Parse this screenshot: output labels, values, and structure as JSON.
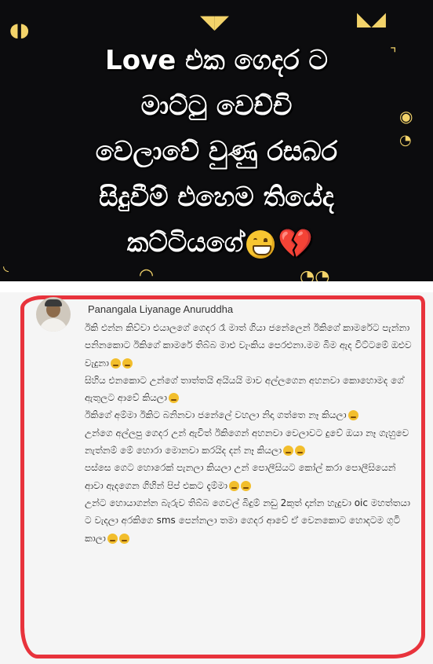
{
  "banner": {
    "lines": [
      "Love එක ගෙදර ට",
      "මාට්ටු වෙච්චි",
      "වෙලාවේ වුණු රසබර",
      "සිදුවීම් එහෙම තියේද",
      "කට්ටියගේ"
    ],
    "emoji_end": [
      "grinning-face-icon",
      "broken-heart-icon"
    ]
  },
  "comment": {
    "author": "Panangala Liyanage Anuruddha",
    "paragraphs": [
      "ඊකි එන්න කිව්වා එයාලගේ ගෙදර රෑ මාත් ගියා ජනේලෙන් ඊකිගේ කාමරේට පැන්නා පනිනකොට ඊකිගේ කාමරේ තිබ්බ මාළු වැංකිය පෙරළුනා.මම බිම ඇද විට්ටමේ ඔළුව වැදුනා",
      "සිහිය එනකොට උන්ගේ තාත්තයි අයියයි මාව අල්ලගෙන අහනවා කොහොමද ගේ ඇතුලට ආවේ කියලා",
      "ඊකිගේ අම්මා ඊකිට බනිනවා ජනේලේ වහලා නිදා ගත්තෙ නෑ කියලා",
      "උන්ගෙ අල්ලපු ගෙදර උන් ඇවිත් ඊකිගෙන් අහනවා වෙලාවට දුවේ ඔයා නෑ ගැහුවෙ නැත්නම් මේ හොරා මොනවා කරයිද දන් නෑ කියලා",
      "පස්සෙ ගෙට හොරෙක් පැනලා කියලා උන් පොලීසියට කෝල් කරා පොලීසියෙන් ආවා ඇදගෙන ගිහින් පිප් එකට දැම්මා",
      "උන්ට හොයාගන්න බැරුව තිබ්බ ගෙවල් බිදුම් නඩු 2කුත් දාන්න හැදුවා oic මහත්තයා ට වැදලා අරකිගෙ sms පෙන්නලා තමා ගෙදර ආවේ ඒ වෙනකොට හොදටම ගුටි කාලා"
    ],
    "emoji_counts": [
      2,
      1,
      1,
      2,
      2,
      2
    ]
  },
  "colors": {
    "banner_bg": "#0c0c0e",
    "frame_red": "#e8333c",
    "eye_yellow": "#f3d36a"
  }
}
